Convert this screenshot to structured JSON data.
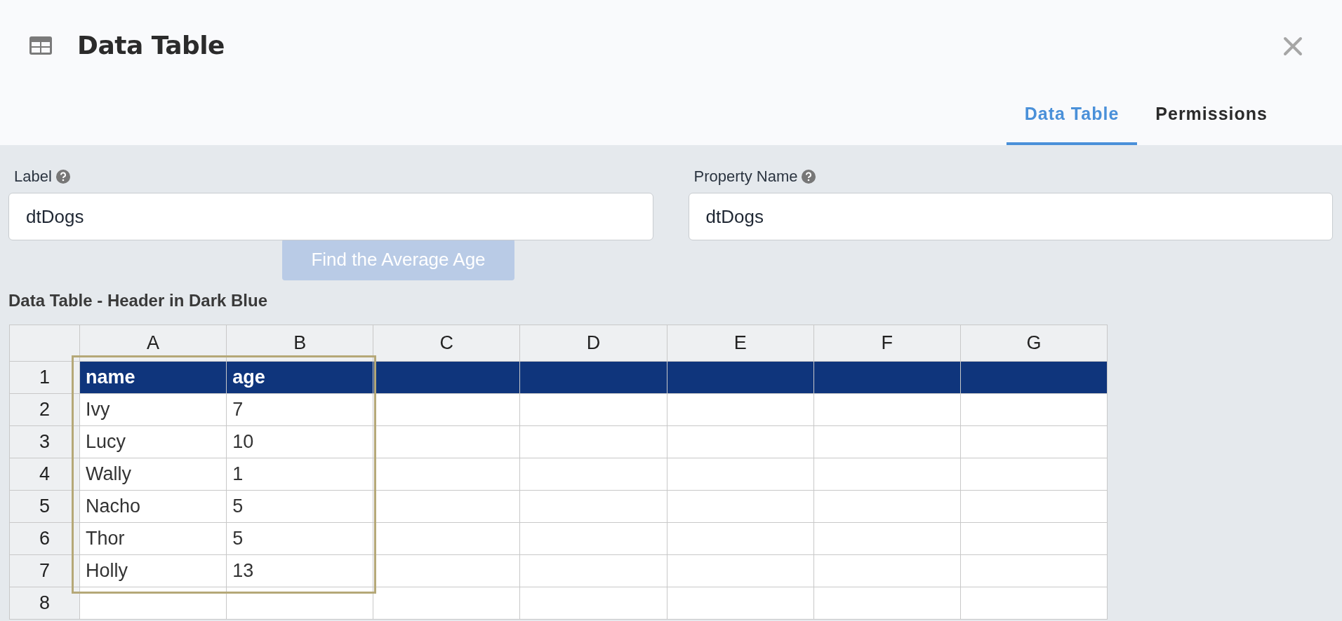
{
  "dialog": {
    "title": "Data Table"
  },
  "tabs": [
    {
      "label": "Data Table",
      "selected": true
    },
    {
      "label": "Permissions",
      "selected": false
    }
  ],
  "background": {
    "button": "Find the Average Age"
  },
  "fields": [
    {
      "label": "Label",
      "value": "dtDogs"
    },
    {
      "label": "Property Name",
      "value": "dtDogs"
    }
  ],
  "table": {
    "title": "Data Table - Header in Dark Blue",
    "columns": [
      "A",
      "B",
      "C",
      "D",
      "E",
      "F",
      "G"
    ],
    "rows": [
      {
        "number": "1",
        "kind": "header",
        "cells": [
          "name",
          "age"
        ]
      },
      {
        "number": "2",
        "kind": "data",
        "cells": [
          "Ivy",
          "7"
        ]
      },
      {
        "number": "3",
        "kind": "data",
        "cells": [
          "Lucy",
          "10"
        ]
      },
      {
        "number": "4",
        "kind": "data",
        "cells": [
          "Wally",
          "1"
        ]
      },
      {
        "number": "5",
        "kind": "data",
        "cells": [
          "Nacho",
          "5"
        ]
      },
      {
        "number": "6",
        "kind": "data",
        "cells": [
          "Thor",
          "5"
        ]
      },
      {
        "number": "7",
        "kind": "data",
        "cells": [
          "Holly",
          "13"
        ]
      },
      {
        "number": "8",
        "kind": "data",
        "cells": []
      }
    ]
  }
}
